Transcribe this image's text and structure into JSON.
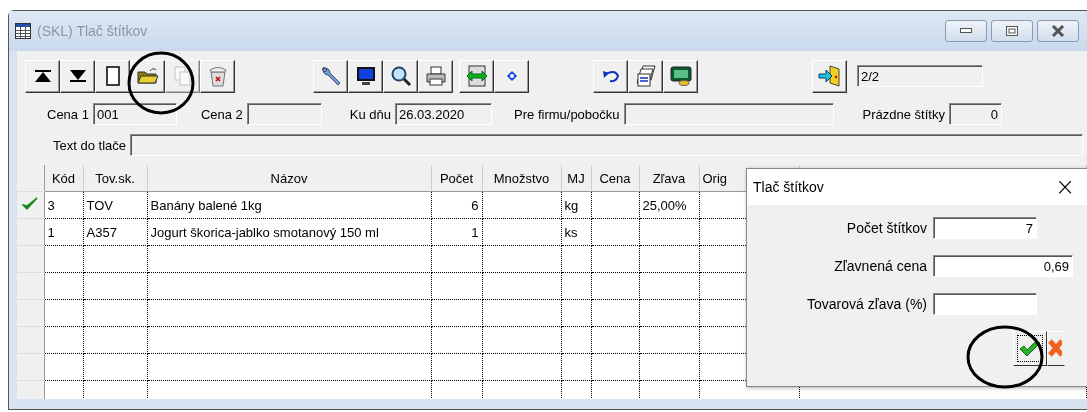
{
  "window": {
    "title": "(SKL) Tlač štítkov"
  },
  "toolbar": [
    {
      "kind": "first",
      "disabled": false
    },
    {
      "kind": "last",
      "disabled": false
    },
    {
      "kind": "page",
      "disabled": false
    },
    {
      "kind": "folder",
      "disabled": false
    },
    {
      "kind": "copy",
      "disabled": true
    },
    {
      "kind": "trash",
      "disabled": false
    },
    {
      "kind": "wrench",
      "disabled": false
    },
    {
      "kind": "monitor",
      "disabled": false
    },
    {
      "kind": "search",
      "disabled": false
    },
    {
      "kind": "printer",
      "disabled": false
    },
    {
      "kind": "columns",
      "disabled": false
    },
    {
      "kind": "dot",
      "disabled": false
    },
    {
      "kind": "undo",
      "disabled": false
    },
    {
      "kind": "stack",
      "disabled": false
    },
    {
      "kind": "money",
      "disabled": false
    },
    {
      "kind": "exit",
      "disabled": false
    }
  ],
  "record_counter": "2/2",
  "filters": [
    {
      "label": "Cena 1",
      "value": "001"
    },
    {
      "label": "Cena 2"
    },
    {
      "label": "Ku dňu",
      "value": "26.03.2020"
    },
    {
      "label": "Pre firmu/pobočku"
    },
    {
      "label": "Prázdne štítky",
      "value": "0"
    }
  ],
  "print_text": {
    "label": "Text do tlače"
  },
  "table": {
    "columns": [
      "Kód",
      "Tov.sk.",
      "Názov",
      "Počet",
      "Množstvo",
      "MJ",
      "Cena",
      "Zľava",
      "Orig"
    ],
    "rows": [
      {
        "marked": true,
        "cells": [
          "3",
          "TOV",
          "Banány balené 1kg",
          "6",
          "",
          "kg",
          "",
          "25,00%",
          ""
        ]
      },
      {
        "marked": false,
        "cells": [
          "1",
          "A357",
          "Jogurt škorica-jablko smotanový 150 ml",
          "1",
          "",
          "ks",
          "",
          "",
          ""
        ]
      }
    ]
  },
  "dialog": {
    "title": "Tlač štítkov",
    "close": "×",
    "fields": [
      {
        "label": "Počet štítkov",
        "value": "7"
      },
      {
        "label": "Zľavnená cena",
        "value": "0,69"
      },
      {
        "label": "Tovarová zľava (%)"
      }
    ]
  }
}
